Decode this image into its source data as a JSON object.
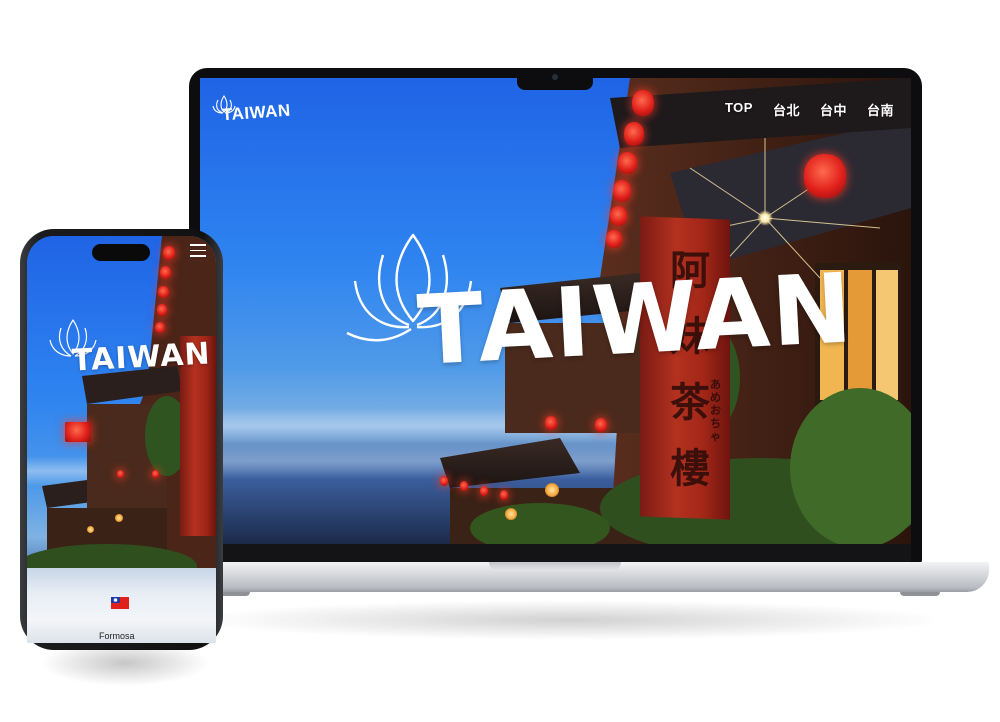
{
  "laptop": {
    "site_logo_text": "TAIWAN",
    "nav": {
      "items": [
        {
          "label": "TOP"
        },
        {
          "label": "台北"
        },
        {
          "label": "台中"
        },
        {
          "label": "台南"
        }
      ]
    },
    "hero": {
      "title": "TAIWAN",
      "banner_chars": "阿妹茶樓",
      "banner_kana": "あめおちゃ"
    }
  },
  "phone": {
    "site_logo_text": "TAIWAN",
    "menu_icon": "hamburger-menu-icon",
    "footer": {
      "flag_icon": "taiwan-flag-icon",
      "caption": "Formosa"
    }
  },
  "colors": {
    "sky_blue": "#2f84f0",
    "lantern_red": "#e0201b",
    "banner_red": "#b3311f",
    "logo_white": "#ffffff"
  }
}
